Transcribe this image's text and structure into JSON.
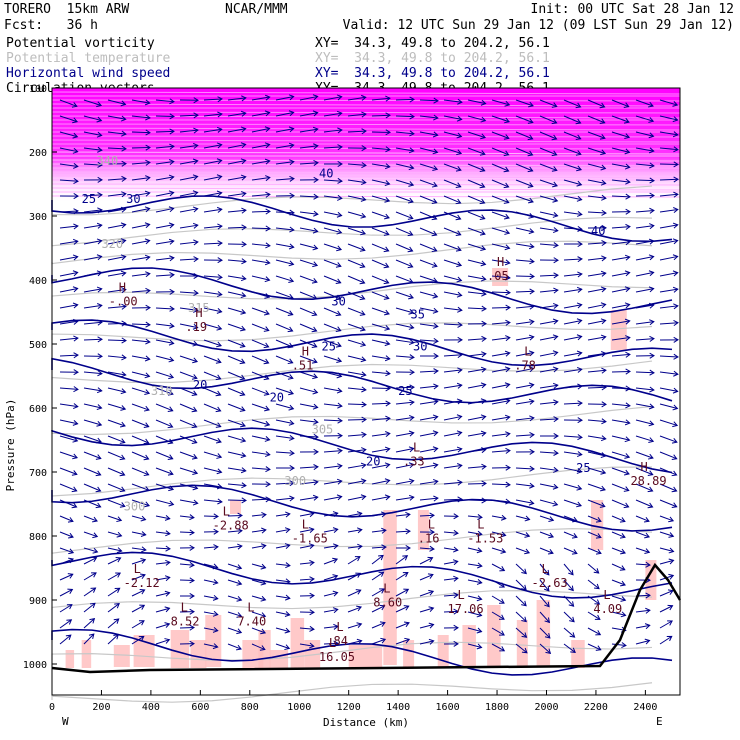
{
  "header": {
    "model": "TORERO  15km ARW",
    "center": "NCAR/MMM",
    "init": "Init: 00 UTC Sat 28 Jan 12",
    "fcst": "Fcst:   36 h",
    "valid": "Valid: 12 UTC Sun 29 Jan 12 (09 LST Sun 29 Jan 12)"
  },
  "fields": [
    {
      "name": "Potential vorticity",
      "xy": "XY=  34.3, 49.8 to 204.2, 56.1",
      "color": "#000000"
    },
    {
      "name": "Potential temperature",
      "xy": "XY=  34.3, 49.8 to 204.2, 56.1",
      "color": "#bdbdbd"
    },
    {
      "name": "Horizontal wind speed",
      "xy": "XY=  34.3, 49.8 to 204.2, 56.1",
      "color": "#00008b"
    },
    {
      "name": "Circulation vectors",
      "xy": "XY=  34.3, 49.8 to 204.2, 56.1",
      "color": "#000000"
    }
  ],
  "chart_data": {
    "type": "cross-section",
    "xlabel": "Distance (km)",
    "ylabel": "Pressure (hPa)",
    "xlim": [
      0,
      2540
    ],
    "ylim": [
      1050,
      100
    ],
    "xticks": [
      "0",
      "200",
      "400",
      "600",
      "800",
      "1000",
      "1200",
      "1400",
      "1600",
      "1800",
      "2000",
      "2200",
      "2400"
    ],
    "yticks": [
      "100",
      "200",
      "300",
      "400",
      "500",
      "600",
      "700",
      "800",
      "900",
      "1000"
    ],
    "x_end_labels": {
      "left": "W",
      "right": "E"
    },
    "wind_speed_labels": [
      {
        "x": 120,
        "p": 280,
        "text": "25"
      },
      {
        "x": 300,
        "p": 280,
        "text": "30"
      },
      {
        "x": 1130,
        "p": 440,
        "text": "30"
      },
      {
        "x": 1450,
        "p": 460,
        "text": "35"
      },
      {
        "x": 1090,
        "p": 510,
        "text": "25"
      },
      {
        "x": 1460,
        "p": 510,
        "text": "30"
      },
      {
        "x": 570,
        "p": 570,
        "text": "20"
      },
      {
        "x": 880,
        "p": 590,
        "text": "20"
      },
      {
        "x": 1400,
        "p": 580,
        "text": "25"
      },
      {
        "x": 1270,
        "p": 690,
        "text": "20"
      },
      {
        "x": 2120,
        "p": 700,
        "text": "25"
      },
      {
        "x": 2180,
        "p": 330,
        "text": "40"
      },
      {
        "x": 1080,
        "p": 240,
        "text": "40"
      }
    ],
    "theta_labels": [
      {
        "x": 200,
        "p": 350,
        "text": "320"
      },
      {
        "x": 550,
        "p": 450,
        "text": "315"
      },
      {
        "x": 400,
        "p": 580,
        "text": "310"
      },
      {
        "x": 1050,
        "p": 640,
        "text": "305"
      },
      {
        "x": 940,
        "p": 720,
        "text": "300"
      },
      {
        "x": 290,
        "p": 760,
        "text": "300"
      },
      {
        "x": 180,
        "p": 220,
        "text": "340"
      }
    ],
    "extrema": [
      {
        "x": 270,
        "p": 440,
        "type": "H",
        "value": "-.00"
      },
      {
        "x": 580,
        "p": 480,
        "type": "H",
        "value": ".19"
      },
      {
        "x": 1010,
        "p": 540,
        "type": "H",
        "value": ".51"
      },
      {
        "x": 1800,
        "p": 400,
        "type": "H",
        "value": ".05"
      },
      {
        "x": 2380,
        "p": 720,
        "type": "H",
        "value": "28.89"
      },
      {
        "x": 1460,
        "p": 690,
        "type": "L",
        "value": ".33"
      },
      {
        "x": 690,
        "p": 790,
        "type": "L",
        "value": "-2.88"
      },
      {
        "x": 1010,
        "p": 810,
        "type": "L",
        "value": "-1.65"
      },
      {
        "x": 1520,
        "p": 810,
        "type": "L",
        "value": ".16"
      },
      {
        "x": 1720,
        "p": 810,
        "type": "L",
        "value": "-1.53"
      },
      {
        "x": 330,
        "p": 880,
        "type": "L",
        "value": "-2.12"
      },
      {
        "x": 1980,
        "p": 880,
        "type": "L",
        "value": "-2.63"
      },
      {
        "x": 520,
        "p": 940,
        "type": "L",
        "value": "8.52"
      },
      {
        "x": 790,
        "p": 940,
        "type": "L",
        "value": "7.40"
      },
      {
        "x": 1340,
        "p": 910,
        "type": "L",
        "value": "8.60"
      },
      {
        "x": 1640,
        "p": 920,
        "type": "L",
        "value": "17.06"
      },
      {
        "x": 1150,
        "p": 970,
        "type": "L",
        "value": ".84"
      },
      {
        "x": 1120,
        "p": 995,
        "type": "L",
        "value": "16.05"
      },
      {
        "x": 2230,
        "p": 920,
        "type": "L",
        "value": "4.09"
      },
      {
        "x": 1910,
        "p": 540,
        "type": "L",
        "value": ".78"
      }
    ]
  }
}
